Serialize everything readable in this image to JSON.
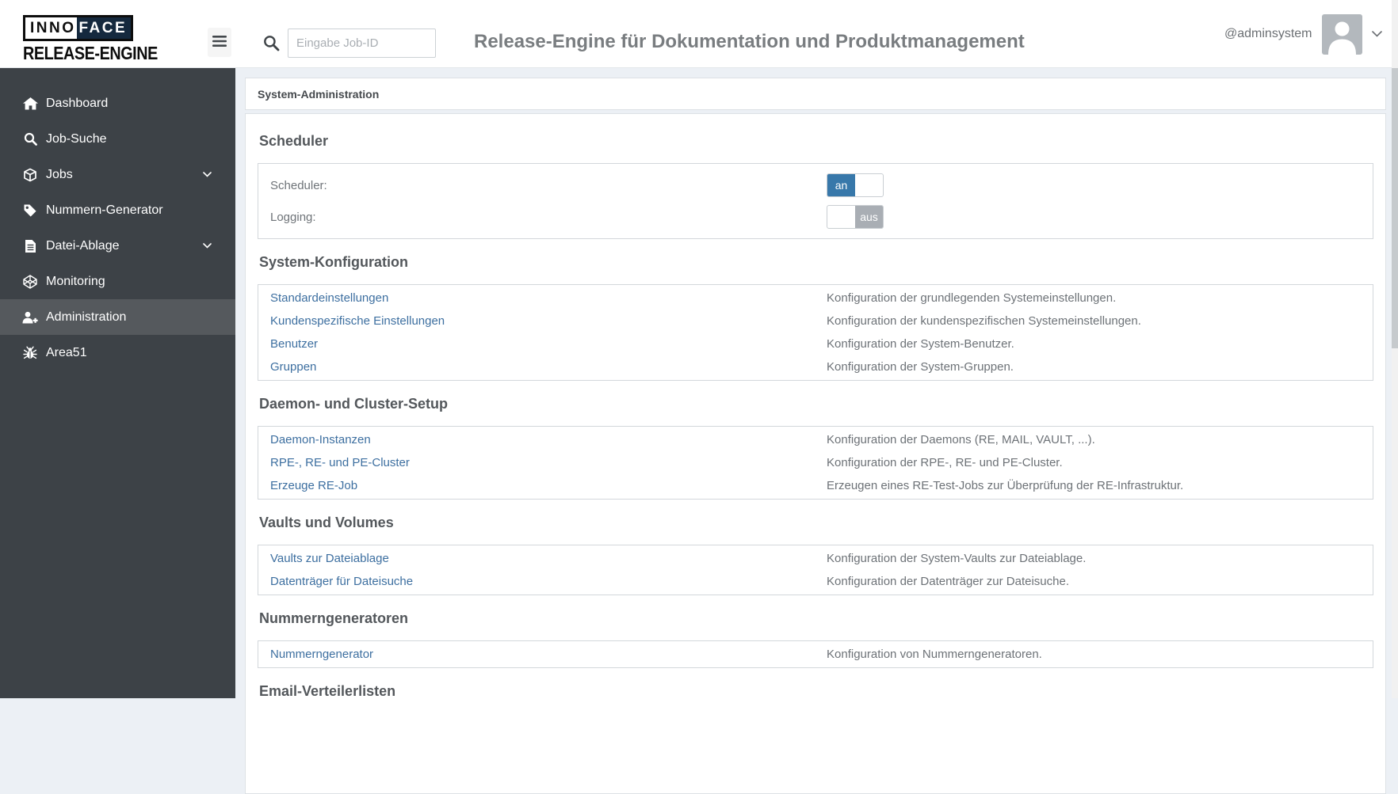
{
  "header": {
    "logo": {
      "part1": "INNO",
      "part2": "FACE",
      "line2": "RELEASE-ENGINE"
    },
    "hamburger_icon": "bars-icon",
    "search": {
      "icon": "search-icon",
      "placeholder": "Eingabe Job-ID",
      "value": ""
    },
    "title": "Release-Engine für Dokumentation und Produktmanagement",
    "user": {
      "name": "@adminsystem",
      "avatar_icon": "person-icon",
      "menu_icon": "chevron-down-icon"
    }
  },
  "sidebar": {
    "items": [
      {
        "label": "Dashboard",
        "icon": "home-icon",
        "active": false,
        "expandable": false
      },
      {
        "label": "Job-Suche",
        "icon": "search-icon",
        "active": false,
        "expandable": false
      },
      {
        "label": "Jobs",
        "icon": "cube-icon",
        "active": false,
        "expandable": true
      },
      {
        "label": "Nummern-Generator",
        "icon": "tag-icon",
        "active": false,
        "expandable": false
      },
      {
        "label": "Datei-Ablage",
        "icon": "file-icon",
        "active": false,
        "expandable": true
      },
      {
        "label": "Monitoring",
        "icon": "codepen-icon",
        "active": false,
        "expandable": false
      },
      {
        "label": "Administration",
        "icon": "user-plus-icon",
        "active": true,
        "expandable": false
      },
      {
        "label": "Area51",
        "icon": "bug-icon",
        "active": false,
        "expandable": false
      }
    ]
  },
  "breadcrumb": "System-Administration",
  "sections": [
    {
      "title": "Scheduler",
      "type": "toggles",
      "rows": [
        {
          "label": "Scheduler:",
          "value": "an",
          "state": "on"
        },
        {
          "label": "Logging:",
          "value": "aus",
          "state": "off"
        }
      ]
    },
    {
      "title": "System-Konfiguration",
      "type": "links",
      "rows": [
        {
          "link": "Standardeinstellungen",
          "description": "Konfiguration der grundlegenden Systemeinstellungen."
        },
        {
          "link": "Kundenspezifische Einstellungen",
          "description": "Konfiguration der kundenspezifischen Systemeinstellungen."
        },
        {
          "link": "Benutzer",
          "description": "Konfiguration der System-Benutzer."
        },
        {
          "link": "Gruppen",
          "description": "Konfiguration der System-Gruppen."
        }
      ]
    },
    {
      "title": "Daemon- und Cluster-Setup",
      "type": "links",
      "rows": [
        {
          "link": "Daemon-Instanzen",
          "description": "Konfiguration der Daemons (RE, MAIL, VAULT, ...)."
        },
        {
          "link": "RPE-, RE- und PE-Cluster",
          "description": "Konfiguration der RPE-, RE- und PE-Cluster."
        },
        {
          "link": "Erzeuge RE-Job",
          "description": "Erzeugen eines RE-Test-Jobs zur Überprüfung der RE-Infrastruktur."
        }
      ]
    },
    {
      "title": "Vaults und Volumes",
      "type": "links",
      "rows": [
        {
          "link": "Vaults zur Dateiablage",
          "description": "Konfiguration der System-Vaults zur Dateiablage."
        },
        {
          "link": "Datenträger für Dateisuche",
          "description": "Konfiguration der Datenträger zur Dateisuche."
        }
      ]
    },
    {
      "title": "Nummerngeneratoren",
      "type": "links",
      "rows": [
        {
          "link": "Nummerngenerator",
          "description": "Konfiguration von Nummerngeneratoren."
        }
      ]
    },
    {
      "title": "Email-Verteilerlisten",
      "type": "links",
      "rows": []
    }
  ],
  "colors": {
    "page_bg": "#ecf0f5",
    "header_bg": "#ffffff",
    "sidebar_bg": "#3d4247",
    "sidebar_active_bg": "#55595d",
    "toggle_on": "#3878aa",
    "toggle_off": "#a9aeb4",
    "link": "#3d6fa0"
  }
}
